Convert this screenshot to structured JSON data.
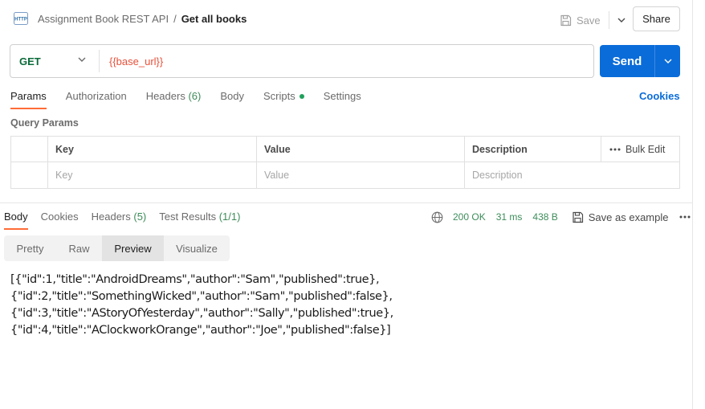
{
  "header": {
    "collection": "Assignment Book REST API",
    "separator": "/",
    "request_name": "Get all books",
    "save_label": "Save",
    "share_label": "Share"
  },
  "url_bar": {
    "method": "GET",
    "url": "{{base_url}}",
    "send_label": "Send"
  },
  "request_tabs": {
    "params": "Params",
    "authorization": "Authorization",
    "headers": "Headers",
    "headers_count": "(6)",
    "body": "Body",
    "scripts": "Scripts",
    "settings": "Settings",
    "cookies": "Cookies"
  },
  "query_params": {
    "title": "Query Params",
    "columns": {
      "key": "Key",
      "value": "Value",
      "description": "Description",
      "bulk_edit": "Bulk Edit"
    },
    "placeholders": {
      "key": "Key",
      "value": "Value",
      "description": "Description"
    }
  },
  "response": {
    "tabs": {
      "body": "Body",
      "cookies": "Cookies",
      "headers": "Headers",
      "headers_count": "(5)",
      "test_results": "Test Results",
      "test_count": "(1/1)"
    },
    "status": "200 OK",
    "time": "31 ms",
    "size": "438 B",
    "save_example": "Save as example",
    "view_tabs": {
      "pretty": "Pretty",
      "raw": "Raw",
      "preview": "Preview",
      "visualize": "Visualize"
    },
    "preview_lines": [
      "[{\"id\":1,\"title\":\"AndroidDreams\",\"author\":\"Sam\",\"published\":true},",
      "{\"id\":2,\"title\":\"SomethingWicked\",\"author\":\"Sam\",\"published\":false},",
      "{\"id\":3,\"title\":\"AStoryOfYesterday\",\"author\":\"Sally\",\"published\":true},",
      "{\"id\":4,\"title\":\"AClockworkOrange\",\"author\":\"Joe\",\"published\":false}]"
    ]
  },
  "colors": {
    "accent_orange": "#ff6c37",
    "send_blue": "#0a6cd9",
    "get_green": "#0b6b3a",
    "url_variable": "#e8513a",
    "status_green": "#3d8c5a"
  }
}
